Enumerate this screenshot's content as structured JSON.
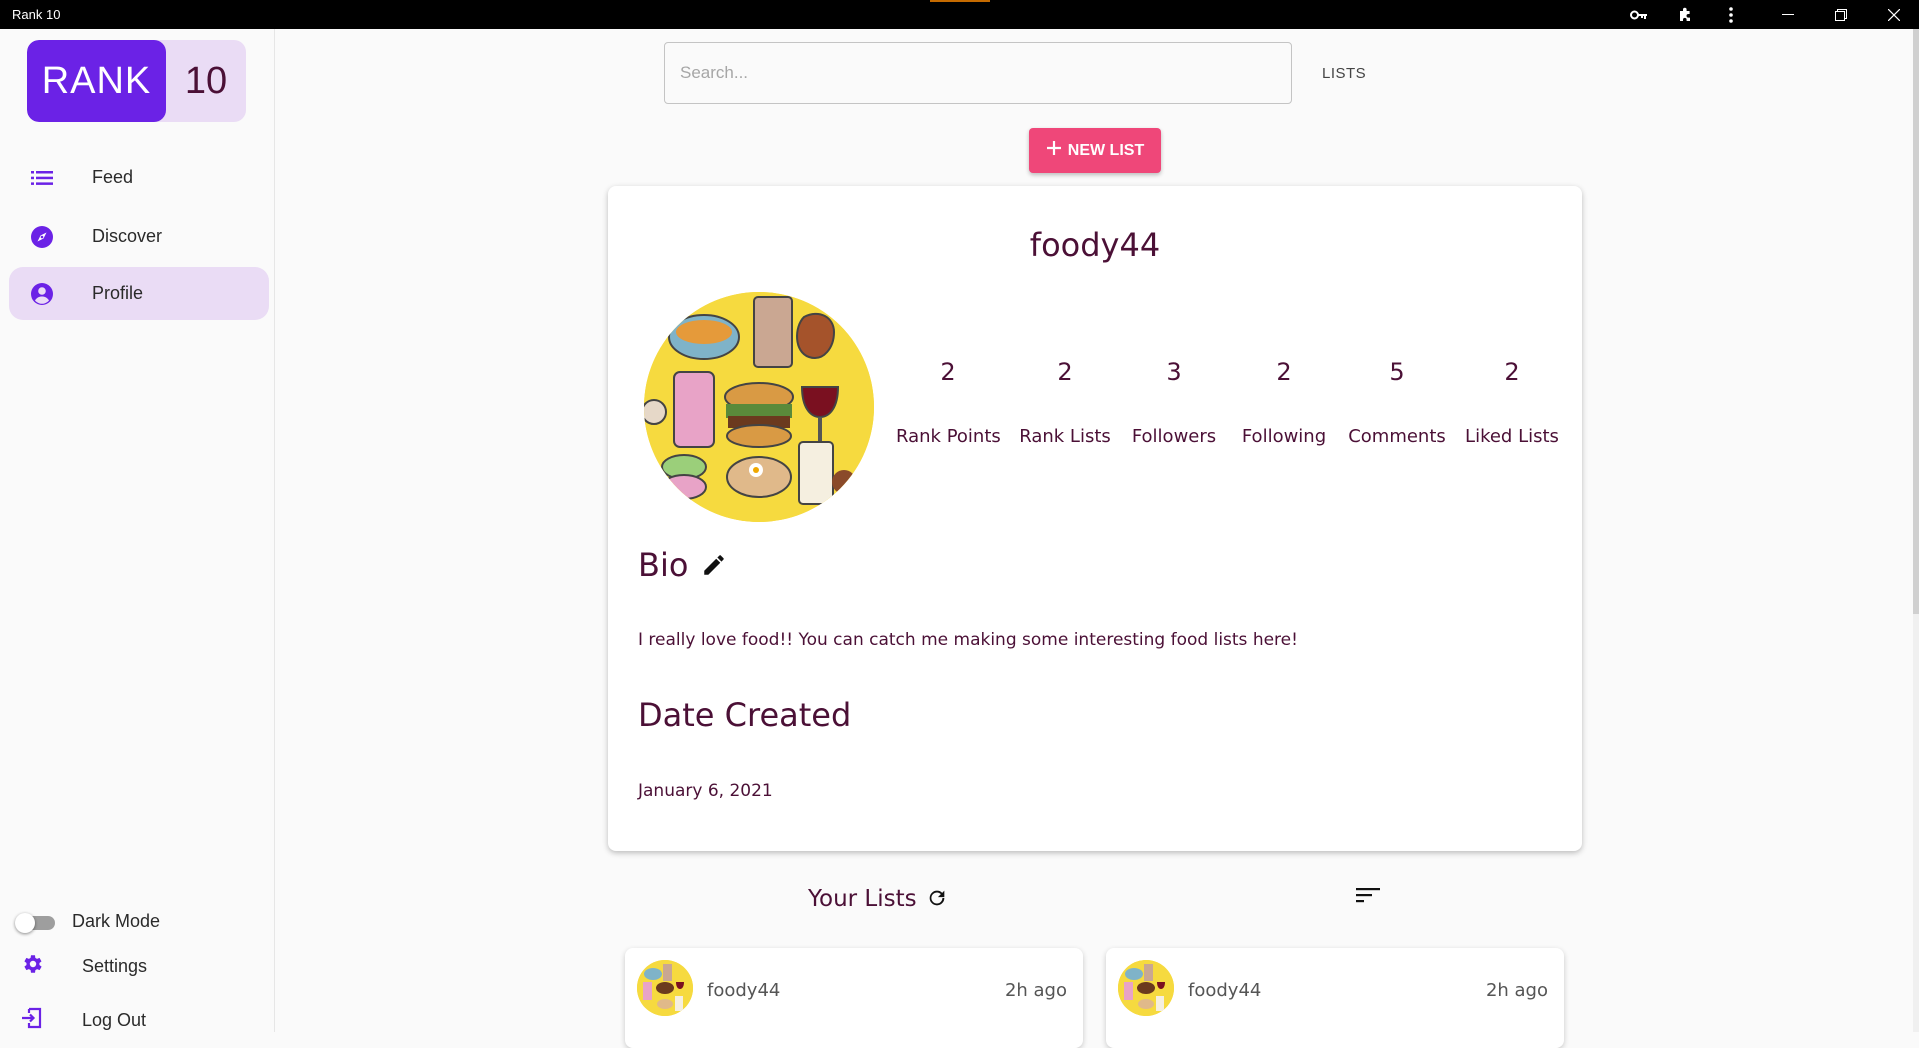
{
  "window": {
    "title": "Rank 10"
  },
  "logo": {
    "rank": "RANK",
    "num": "10"
  },
  "sidebar": {
    "items": [
      {
        "label": "Feed",
        "icon": "list-icon"
      },
      {
        "label": "Discover",
        "icon": "compass-icon"
      },
      {
        "label": "Profile",
        "icon": "account-circle-icon",
        "active": true
      }
    ],
    "dark_mode_label": "Dark Mode",
    "dark_mode_on": false,
    "settings_label": "Settings",
    "logout_label": "Log Out"
  },
  "search": {
    "placeholder": "Search...",
    "value": ""
  },
  "header": {
    "lists_link": "LISTS",
    "new_list_label": "NEW LIST"
  },
  "profile": {
    "username": "foody44",
    "stats": [
      {
        "value": "2",
        "label": "Rank Points"
      },
      {
        "value": "2",
        "label": "Rank Lists"
      },
      {
        "value": "3",
        "label": "Followers"
      },
      {
        "value": "2",
        "label": "Following"
      },
      {
        "value": "5",
        "label": "Comments"
      },
      {
        "value": "2",
        "label": "Liked Lists"
      }
    ],
    "bio_heading": "Bio",
    "bio_text": "I really love food!! You can catch me making some interesting food lists here!",
    "date_heading": "Date Created",
    "date_value": "January 6, 2021"
  },
  "your_lists": {
    "title": "Your Lists",
    "cards": [
      {
        "owner": "foody44",
        "time": "2h ago"
      },
      {
        "owner": "foody44",
        "time": "2h ago"
      }
    ]
  },
  "colors": {
    "brand_purple": "#6b22e6",
    "accent_pink": "#ef4779",
    "text_maroon": "#4b1036",
    "active_bg": "#eadcf5"
  }
}
